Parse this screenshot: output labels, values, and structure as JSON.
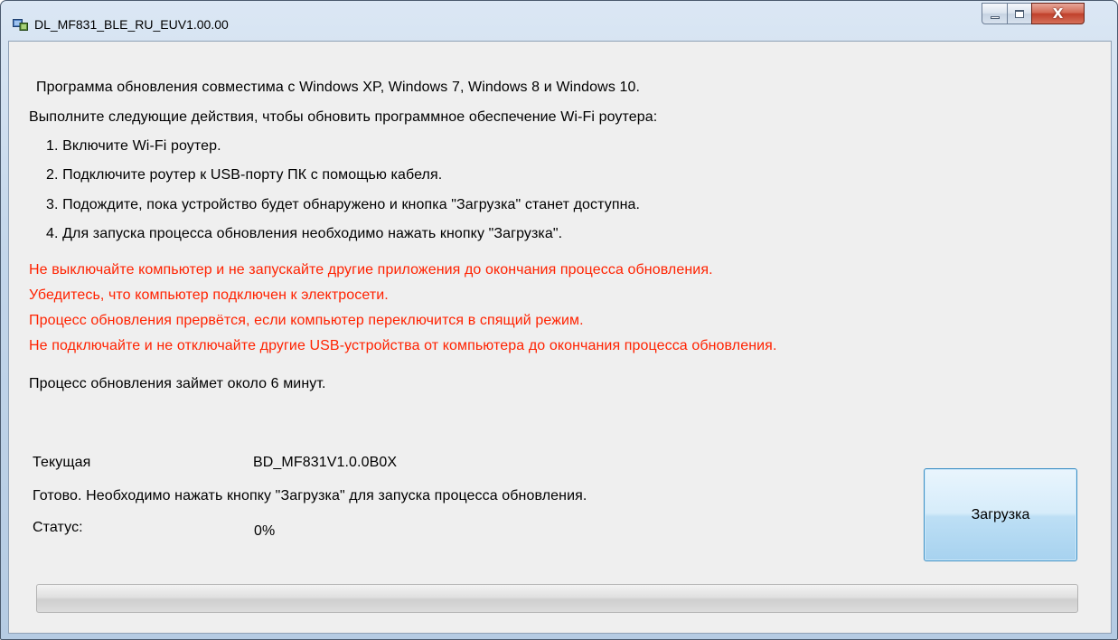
{
  "window": {
    "title": "DL_MF831_BLE_RU_EUV1.00.00",
    "close_glyph": "X"
  },
  "intro": {
    "compat": "Программа обновления совместима с Windows XP, Windows 7, Windows 8 и Windows 10.",
    "instructions_heading": "Выполните следующие действия, чтобы обновить программное обеспечение Wi-Fi роутера:",
    "steps": [
      "1. Включите  Wi-Fi роутер.",
      "2. Подключите роутер к USB-порту ПК с помощью кабеля.",
      "3. Подождите, пока устройство будет обнаружено и кнопка \"Загрузка\" станет доступна.",
      "4. Для запуска процесса обновления необходимо нажать кнопку \"Загрузка\"."
    ]
  },
  "warnings": [
    "Не выключайте компьютер и не запускайте другие приложения до окончания процесса обновления.",
    "Убедитесь, что компьютер подключен к электросети.",
    "Процесс обновления прервётся, если компьютер переключится в спящий режим.",
    "Не подключайте и не отключайте другие USB-устройства от компьютера до окончания процесса обновления."
  ],
  "duration_note": "Процесс обновления займет около 6 минут.",
  "status_panel": {
    "current_label": "Текущая",
    "current_value": "BD_MF831V1.0.0B0X",
    "ready_message": "Готово. Необходимо нажать кнопку \"Загрузка\" для запуска процесса обновления.",
    "status_label": "Статус:",
    "status_value": "0%"
  },
  "download_button_label": "Загрузка",
  "progress": {
    "fraction": 0.0
  },
  "colors": {
    "warning": "#ff2200",
    "progress_fill": "#37b34a"
  }
}
